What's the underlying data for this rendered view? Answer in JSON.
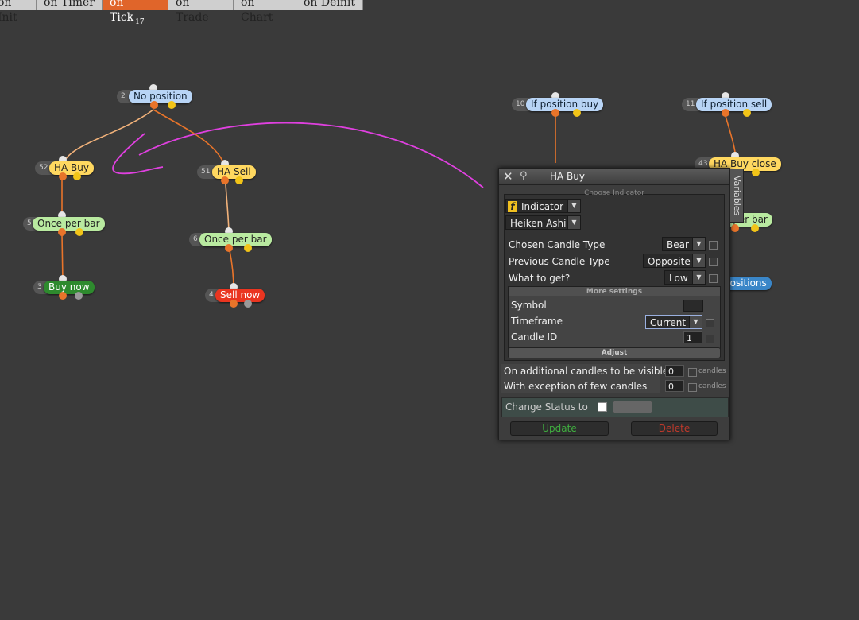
{
  "tabs": [
    "on Init",
    "on Timer",
    "on Tick",
    "on Trade",
    "on Chart",
    "on Deinit"
  ],
  "active_tab_badge": "17",
  "nodes": {
    "n2": {
      "id": "2",
      "label": "No position"
    },
    "n52": {
      "id": "52",
      "label": "HA Buy"
    },
    "n51": {
      "id": "51",
      "label": "HA Sell"
    },
    "n5": {
      "id": "5",
      "label": "Once per bar"
    },
    "n6": {
      "id": "6",
      "label": "Once per bar"
    },
    "n3": {
      "id": "3",
      "label": "Buy now"
    },
    "n4": {
      "id": "4",
      "label": "Sell now"
    },
    "n10": {
      "id": "10",
      "label": "If position buy"
    },
    "n11": {
      "id": "11",
      "label": "If position sell"
    },
    "n43": {
      "id": "43",
      "label": "HA Buy close"
    },
    "n_obar": {
      "label": "e per bar"
    },
    "n_pos": {
      "label": "positions"
    }
  },
  "dialog": {
    "title": "HA Buy",
    "side_tab": "Variables",
    "section_title": "Choose Indicator",
    "indicator_type": "Indicator",
    "indicator_name": "Heiken Ashi",
    "rows": {
      "chosen_candle_type": {
        "label": "Chosen Candle Type",
        "value": "Bear"
      },
      "previous_candle_type": {
        "label": "Previous Candle Type",
        "value": "Opposite"
      },
      "what_to_get": {
        "label": "What to get?",
        "value": "Low"
      }
    },
    "more_settings": "More settings",
    "symbol": {
      "label": "Symbol",
      "value": ""
    },
    "timeframe": {
      "label": "Timeframe",
      "value": "Current"
    },
    "candle_id": {
      "label": "Candle ID",
      "value": "1"
    },
    "adjust": "Adjust",
    "additional": {
      "label": "On additional candles to be visible",
      "value": "0",
      "unit": "candles"
    },
    "exception": {
      "label": "With exception of few candles",
      "value": "0",
      "unit": "candles"
    },
    "change_status": "Change Status to",
    "update": "Update",
    "delete": "Delete"
  },
  "colors": {
    "background": "#3a3a3a",
    "wire": "#e8742a",
    "annotation": "#e040e0",
    "active_tab": "#e0652a"
  }
}
